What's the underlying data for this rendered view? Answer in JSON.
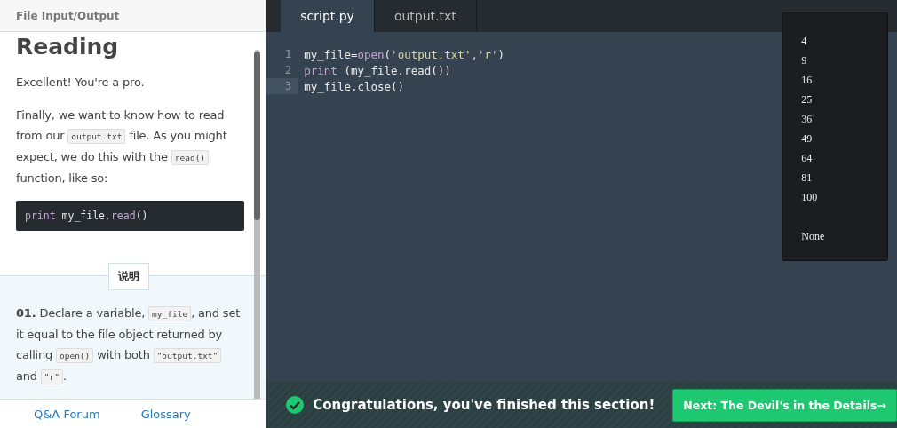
{
  "lesson": {
    "course": "File Input/Output",
    "title": "Reading",
    "paragraphs": [
      [
        {
          "kind": "text",
          "text": "Excellent! You're a pro."
        }
      ],
      [
        {
          "kind": "text",
          "text": "Finally, we want to know how to read from our "
        },
        {
          "kind": "code",
          "text": "output.txt"
        },
        {
          "kind": "text",
          "text": " file. As you might expect, we do this with the "
        },
        {
          "kind": "code",
          "text": "read()"
        },
        {
          "kind": "text",
          "text": " function, like so:"
        }
      ]
    ],
    "code_sample": [
      {
        "kind": "keyword",
        "text": "print "
      },
      {
        "kind": "plain",
        "text": "my_file"
      },
      {
        "kind": "keyword",
        "text": ".read"
      },
      {
        "kind": "plain",
        "text": "()"
      }
    ],
    "instructions_label": "说明",
    "steps": [
      {
        "number": "01.",
        "parts": [
          {
            "kind": "text",
            "text": "Declare a variable, "
          },
          {
            "kind": "code",
            "text": "my_file"
          },
          {
            "kind": "text",
            "text": ", and set it equal to the file object returned by calling "
          },
          {
            "kind": "code",
            "text": "open()"
          },
          {
            "kind": "text",
            "text": " with both "
          },
          {
            "kind": "code",
            "text": "\"output.txt\""
          },
          {
            "kind": "text",
            "text": " and "
          },
          {
            "kind": "code",
            "text": "\"r\""
          },
          {
            "kind": "text",
            "text": "."
          }
        ]
      }
    ]
  },
  "footer_links": [
    "Q&A Forum",
    "Glossary"
  ],
  "tabs": [
    {
      "label": "script.py",
      "selected": true
    },
    {
      "label": "output.txt",
      "selected": false
    }
  ],
  "editor": {
    "lines": [
      {
        "number": "1",
        "active": false,
        "tokens": [
          {
            "kind": "plain",
            "text": "my_file="
          },
          {
            "kind": "keyword",
            "text": "open"
          },
          {
            "kind": "plain",
            "text": "("
          },
          {
            "kind": "string",
            "text": "'output.txt'"
          },
          {
            "kind": "plain",
            "text": ","
          },
          {
            "kind": "string",
            "text": "'r'"
          },
          {
            "kind": "plain",
            "text": ")"
          }
        ]
      },
      {
        "number": "2",
        "active": false,
        "tokens": [
          {
            "kind": "keyword",
            "text": "print"
          },
          {
            "kind": "plain",
            "text": " (my_file.read())"
          }
        ]
      },
      {
        "number": "3",
        "active": true,
        "tokens": [
          {
            "kind": "plain",
            "text": "my_file.close()"
          }
        ]
      }
    ]
  },
  "output": [
    {
      "kind": "value",
      "text": "4"
    },
    {
      "kind": "value",
      "text": "9"
    },
    {
      "kind": "value",
      "text": "16"
    },
    {
      "kind": "value",
      "text": "25"
    },
    {
      "kind": "value",
      "text": "36"
    },
    {
      "kind": "value",
      "text": "49"
    },
    {
      "kind": "value",
      "text": "64"
    },
    {
      "kind": "value",
      "text": "81"
    },
    {
      "kind": "value",
      "text": "100"
    },
    {
      "kind": "result",
      "text": "None"
    }
  ],
  "banner": {
    "message": "Congratulations, you've finished this section!",
    "next_button": "Next: The Devil's in the Details→"
  }
}
